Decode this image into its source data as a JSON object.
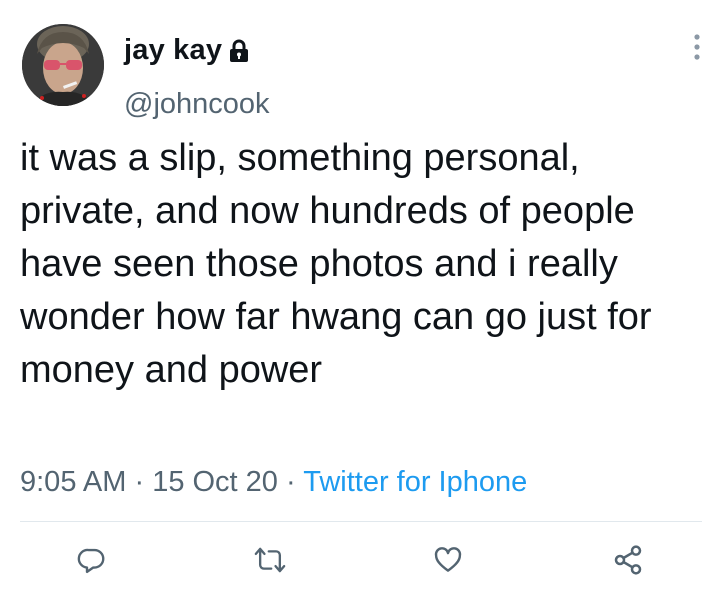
{
  "tweet": {
    "display_name": "jay kay",
    "handle": "@johncook",
    "text": "it was a slip, something personal, private, and now hundreds of people have seen those photos and i really wonder how far hwang can go just for money and power",
    "time": "9:05 AM",
    "separator": "·",
    "date": "15 Oct 20",
    "source": "Twitter for Iphone"
  },
  "icons": {
    "lock": "lock-icon",
    "more": "more-vertical-icon",
    "reply": "reply-icon",
    "retweet": "retweet-icon",
    "like": "heart-icon",
    "share": "share-icon"
  },
  "colors": {
    "text": "#0f1419",
    "secondary": "#536471",
    "link": "#1d9bf0",
    "icon": "#536471"
  }
}
